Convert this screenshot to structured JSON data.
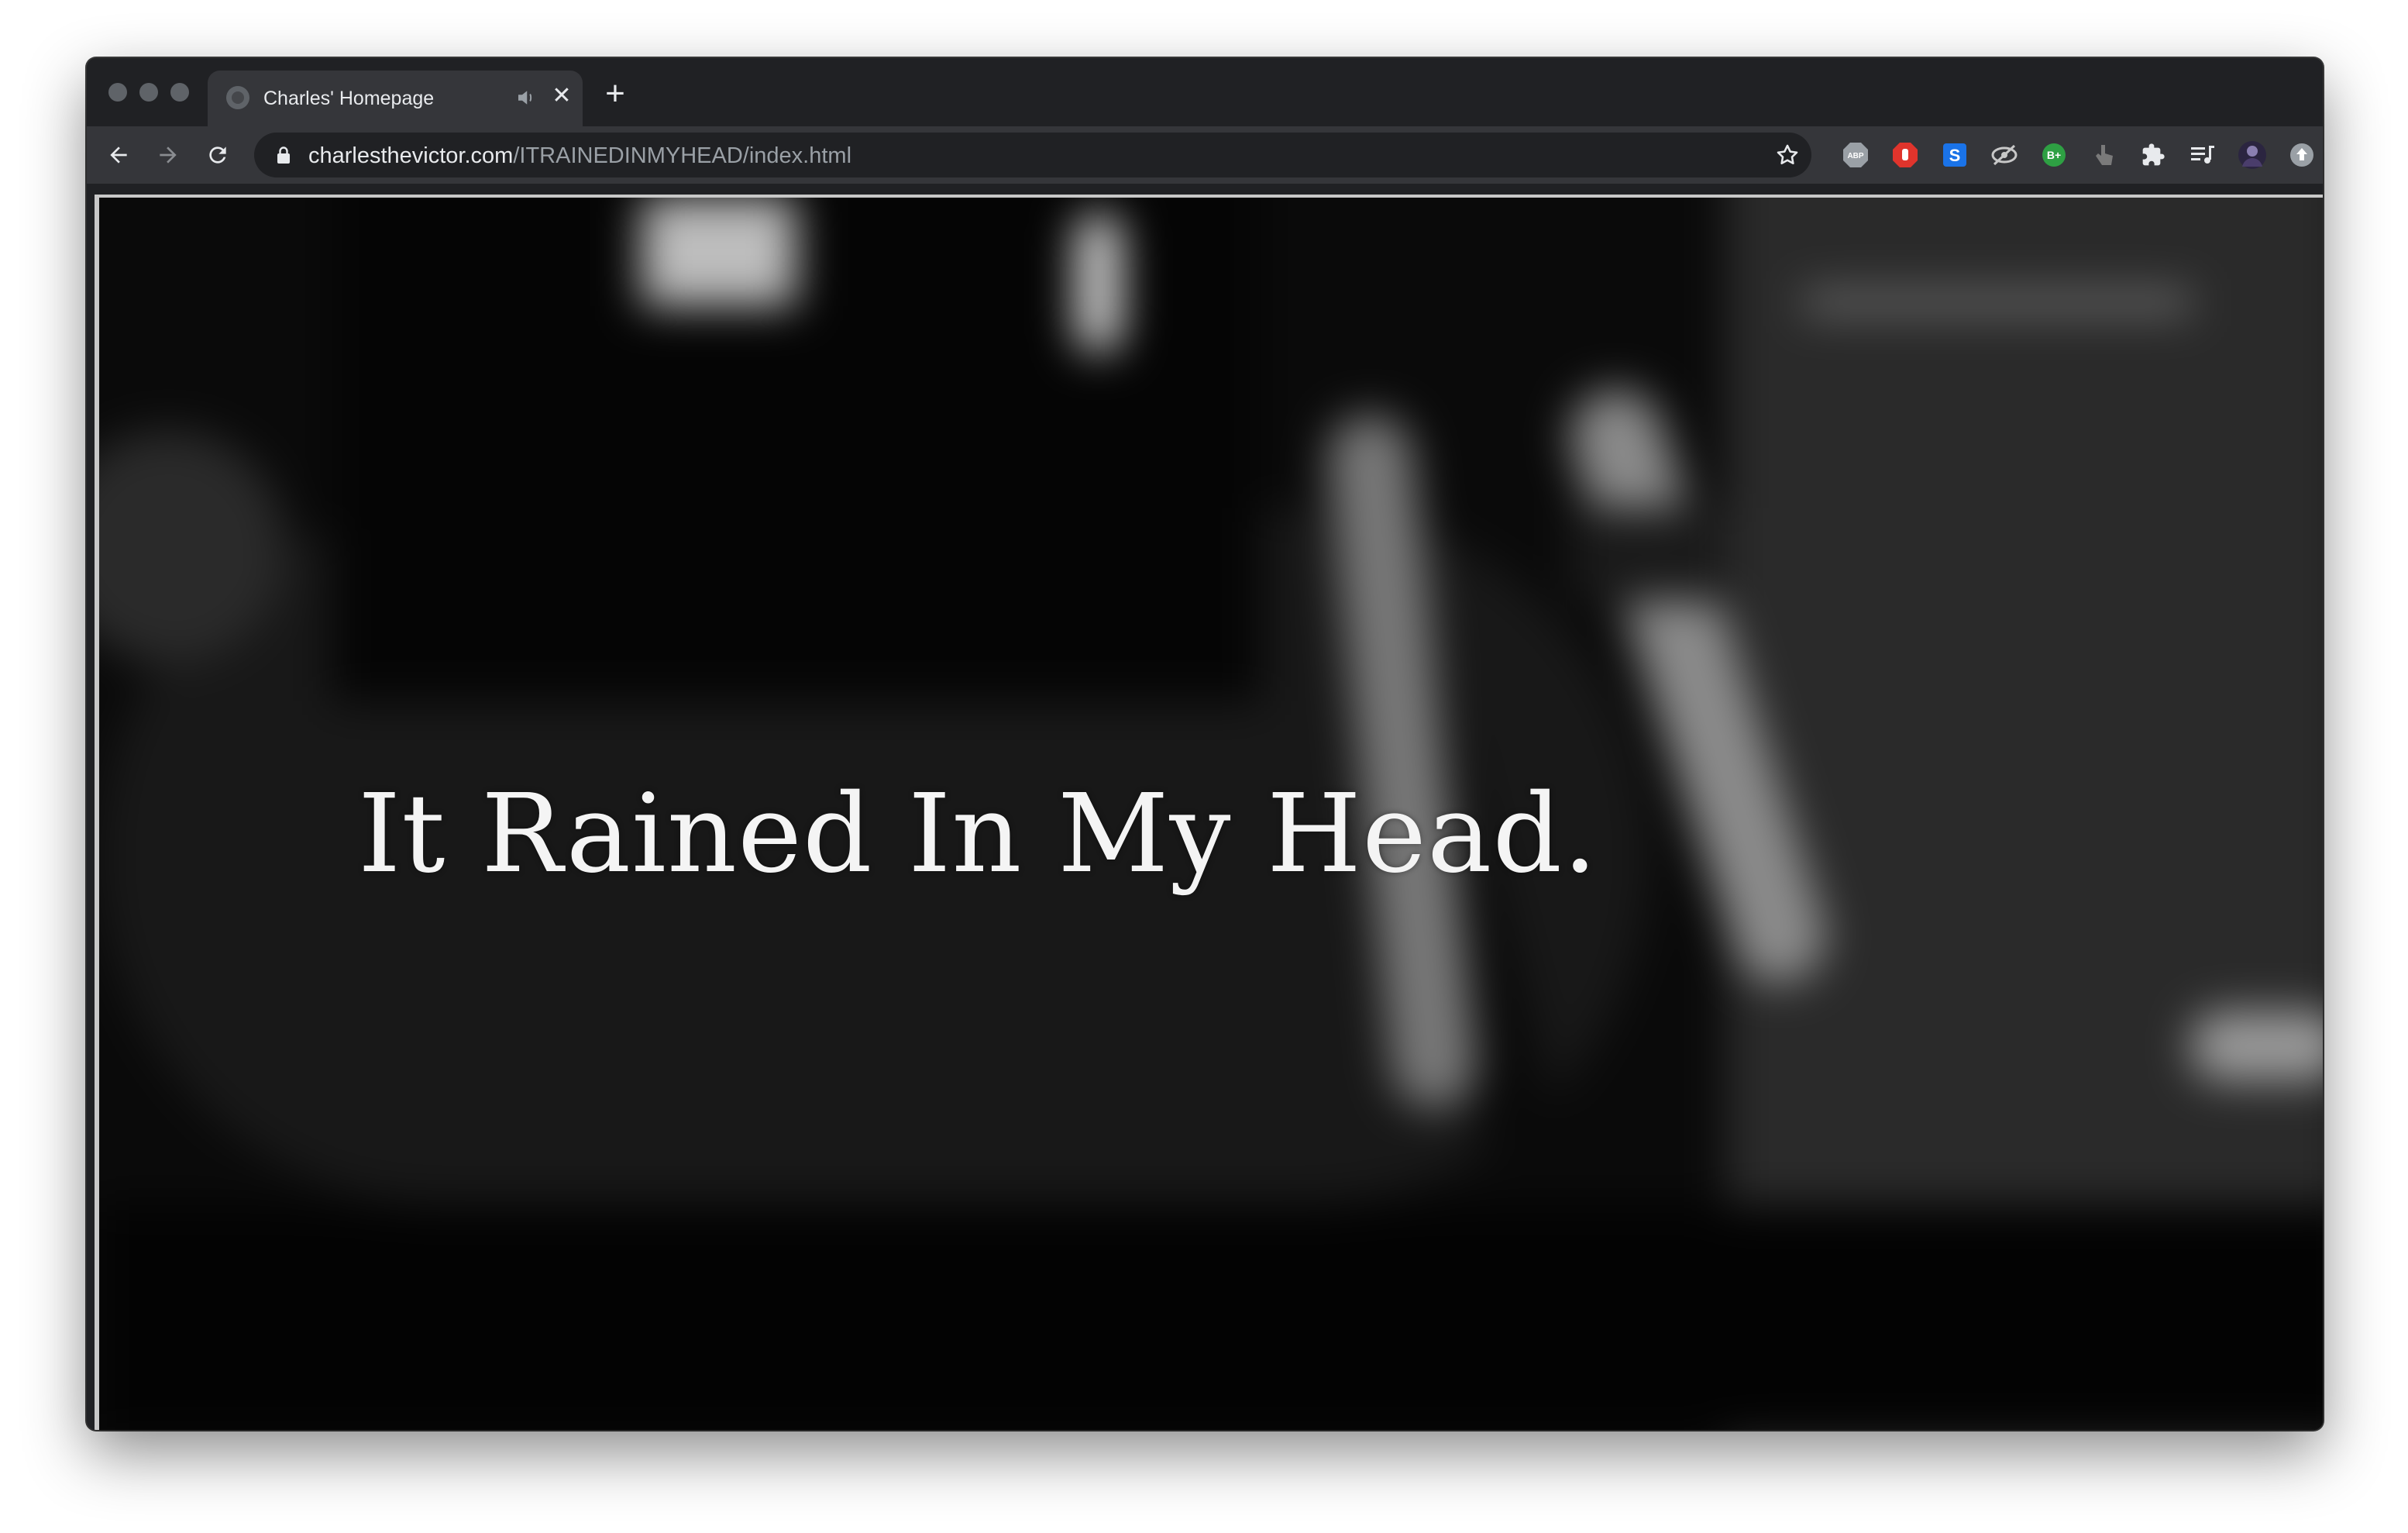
{
  "browser": {
    "tab": {
      "title": "Charles' Homepage",
      "favicon": "globe-icon",
      "audio_icon": "speaker-icon",
      "close_icon": "close-icon"
    },
    "new_tab_icon": "plus-icon",
    "nav": {
      "back_icon": "arrow-left-icon",
      "forward_icon": "arrow-right-icon",
      "reload_icon": "reload-icon"
    },
    "address": {
      "host": "charlesthevictor.com",
      "path": "/ITRAINEDINMYHEAD/index.html",
      "lock_icon": "lock-icon",
      "bookmark_icon": "star-icon"
    },
    "extensions": [
      {
        "name": "abp-extension-icon",
        "label": "ABP",
        "color": "#9aa0a6"
      },
      {
        "name": "stop-hand-extension-icon",
        "label": "",
        "color": "#e0342c"
      },
      {
        "name": "s-extension-icon",
        "label": "S",
        "color": "#1a73e8"
      },
      {
        "name": "eye-slash-extension-icon",
        "label": "",
        "color": "#c8c8c8"
      },
      {
        "name": "b-plus-extension-icon",
        "label": "B+",
        "color": "#2ea043"
      },
      {
        "name": "hand-pointer-extension-icon",
        "label": "",
        "color": "#7a7a7a"
      },
      {
        "name": "puzzle-icon",
        "label": "",
        "color": "#e8eaed"
      },
      {
        "name": "media-queue-icon",
        "label": "",
        "color": "#e8eaed"
      },
      {
        "name": "profile-avatar",
        "label": "",
        "color": "#4a3d6b"
      },
      {
        "name": "update-icon",
        "label": "",
        "color": "#9aa0a6"
      }
    ]
  },
  "page": {
    "headline": "It Rained In My Head."
  }
}
